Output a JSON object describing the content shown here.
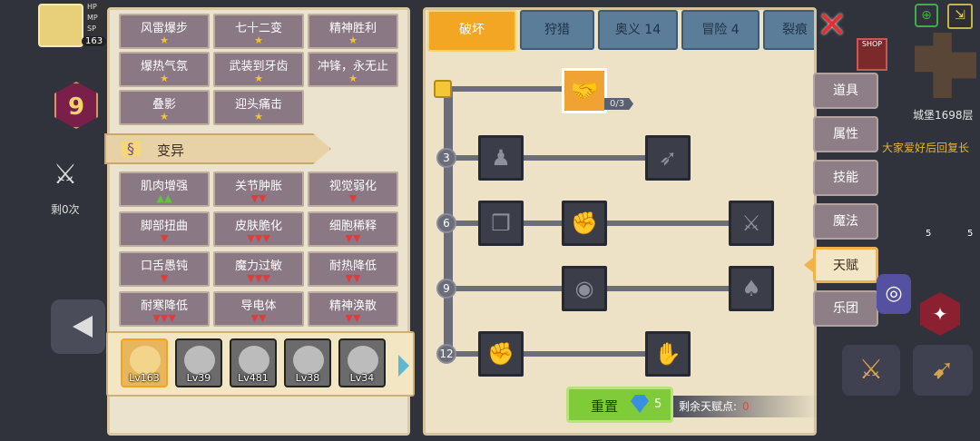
{
  "hud": {
    "player_level": "163",
    "bar_labels": [
      "HP",
      "MP",
      "SP"
    ],
    "floor_badge": "9",
    "remaining_label": "剩0次"
  },
  "left_panel": {
    "top_cells": [
      {
        "name": "风雷爆步",
        "marks": "★"
      },
      {
        "name": "七十二变",
        "marks": "★"
      },
      {
        "name": "精神胜利",
        "marks": "★"
      },
      {
        "name": "爆热气氛",
        "marks": "★"
      },
      {
        "name": "武装到牙齿",
        "marks": "★"
      },
      {
        "name": "冲锋，永无止",
        "marks": "★"
      },
      {
        "name": "叠影",
        "marks": "★"
      },
      {
        "name": "迎头痛击",
        "marks": "★"
      }
    ],
    "section_title": "变异",
    "mutation_cells": [
      {
        "name": "肌肉增强",
        "marks": "▲▲",
        "kind": "up"
      },
      {
        "name": "关节肿胀",
        "marks": "▼▼",
        "kind": "down"
      },
      {
        "name": "视觉弱化",
        "marks": "▼",
        "kind": "down"
      },
      {
        "name": "脚部扭曲",
        "marks": "▼",
        "kind": "down"
      },
      {
        "name": "皮肤脆化",
        "marks": "▼▼▼",
        "kind": "down"
      },
      {
        "name": "细胞稀释",
        "marks": "▼▼",
        "kind": "down"
      },
      {
        "name": "口舌愚钝",
        "marks": "▼",
        "kind": "down"
      },
      {
        "name": "魔力过敏",
        "marks": "▼▼▼",
        "kind": "down"
      },
      {
        "name": "耐热降低",
        "marks": "▼▼",
        "kind": "down"
      },
      {
        "name": "耐寒降低",
        "marks": "▼▼▼",
        "kind": "down"
      },
      {
        "name": "导电体",
        "marks": "▼▼",
        "kind": "down"
      },
      {
        "name": "精神涣散",
        "marks": "▼▼",
        "kind": "down"
      }
    ],
    "heroes": [
      {
        "level": "Lv163",
        "selected": true
      },
      {
        "level": "Lv39",
        "selected": false
      },
      {
        "level": "Lv481",
        "selected": false
      },
      {
        "level": "Lv38",
        "selected": false
      },
      {
        "level": "Lv34",
        "selected": false
      }
    ]
  },
  "tabs": [
    {
      "label": "破坏",
      "active": true
    },
    {
      "label": "狩猎",
      "active": false
    },
    {
      "label": "奥义 14",
      "active": false
    },
    {
      "label": "冒险 4",
      "active": false
    },
    {
      "label": "裂痕",
      "active": false
    }
  ],
  "talent_tree": {
    "top_talent_count": "0/3",
    "tier_numbers": [
      "3",
      "6",
      "9",
      "12"
    ],
    "talents": [
      {
        "icon": "handshake-icon",
        "glyph": "🤝",
        "lit": true
      },
      {
        "icon": "body-icon",
        "glyph": "♟",
        "lit": false
      },
      {
        "icon": "arrow-burst-icon",
        "glyph": "➶",
        "lit": false
      },
      {
        "icon": "book-icon",
        "glyph": "❒",
        "lit": false
      },
      {
        "icon": "punch-icon",
        "glyph": "✊",
        "lit": false
      },
      {
        "icon": "blade-icon",
        "glyph": "⚔",
        "lit": false
      },
      {
        "icon": "ripple-icon",
        "glyph": "◉",
        "lit": false
      },
      {
        "icon": "drops-icon",
        "glyph": "♠",
        "lit": false
      },
      {
        "icon": "fist-icon",
        "glyph": "✊",
        "lit": false
      },
      {
        "icon": "grip-icon",
        "glyph": "✋",
        "lit": false
      }
    ]
  },
  "reset": {
    "label": "重置",
    "gem_count": "5"
  },
  "remaining_points": {
    "label": "剩余天赋点:",
    "value": "0"
  },
  "side_menu": [
    {
      "label": "道具",
      "active": false
    },
    {
      "label": "属性",
      "active": false
    },
    {
      "label": "技能",
      "active": false
    },
    {
      "label": "魔法",
      "active": false
    },
    {
      "label": "天赋",
      "active": true
    },
    {
      "label": "乐团",
      "active": false
    }
  ],
  "right_hud": {
    "floor_label": "城堡1698层",
    "chat_text": "大家爱好后回复长",
    "shop_label": "SHOP",
    "item_counts": [
      "5",
      "5"
    ]
  },
  "colors": {
    "accent": "#f3a624",
    "tab": "#5b7d9a",
    "reset_green": "#7fcb3a",
    "down": "#e23b3b",
    "up": "#61c43a"
  }
}
